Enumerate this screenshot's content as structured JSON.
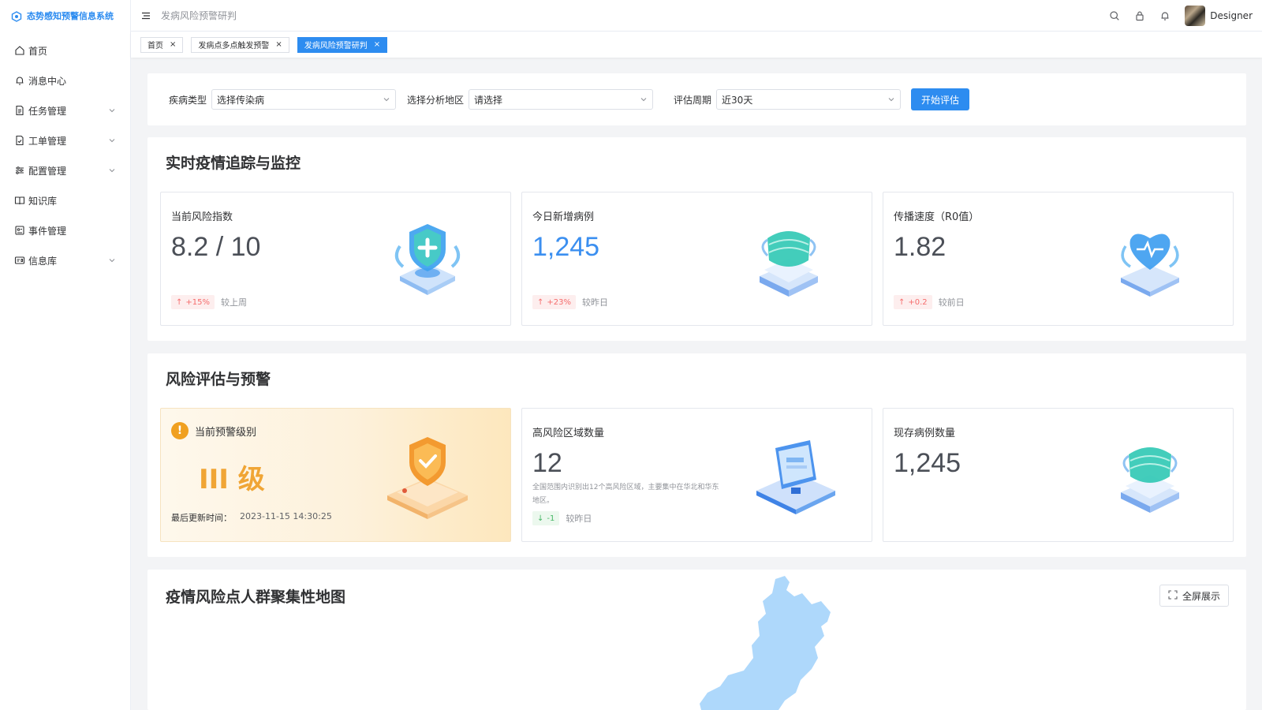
{
  "app": {
    "title": "态势感知预警信息系统"
  },
  "sidebar": {
    "items": [
      {
        "label": "首页",
        "icon": "home-icon",
        "has_children": false
      },
      {
        "label": "消息中心",
        "icon": "bell-icon",
        "has_children": false
      },
      {
        "label": "任务管理",
        "icon": "document-icon",
        "has_children": true
      },
      {
        "label": "工单管理",
        "icon": "file-check-icon",
        "has_children": true
      },
      {
        "label": "配置管理",
        "icon": "sliders-icon",
        "has_children": true
      },
      {
        "label": "知识库",
        "icon": "book-icon",
        "has_children": false
      },
      {
        "label": "事件管理",
        "icon": "event-icon",
        "has_children": false
      },
      {
        "label": "信息库",
        "icon": "id-card-icon",
        "has_children": true
      }
    ]
  },
  "header": {
    "breadcrumb": "发病风险预警研判",
    "user_name": "Designer"
  },
  "tabs": [
    {
      "label": "首页",
      "active": false
    },
    {
      "label": "发病点多点触发预警",
      "active": false
    },
    {
      "label": "发病风险预警研判",
      "active": true
    }
  ],
  "filters": {
    "disease_label": "疾病类型",
    "disease_value": "选择传染病",
    "region_label": "选择分析地区",
    "region_value": "请选择",
    "period_label": "评估周期",
    "period_value": "近30天",
    "start_button": "开始评估"
  },
  "realtime": {
    "title": "实时疫情追踪与监控",
    "cards": [
      {
        "title": "当前风险指数",
        "value": "8.2 / 10",
        "trend": "+15%",
        "compare": "较上周"
      },
      {
        "title": "今日新增病例",
        "value": "1,245",
        "trend": "+23%",
        "compare": "较昨日"
      },
      {
        "title": "传播速度（R0值）",
        "value": "1.82",
        "trend": "+0.2",
        "compare": "较前日"
      }
    ]
  },
  "risk": {
    "title": "风险评估与预警",
    "warning": {
      "title": "当前预警级别",
      "level": "III 级",
      "updated_label": "最后更新时间：",
      "updated_value": "2023-11-15 14:30:25"
    },
    "high_risk": {
      "title": "高风险区域数量",
      "value": "12",
      "desc": "全国范围内识别出12个高风险区域，主要集中在华北和华东地区。",
      "trend": "-1",
      "compare": "较昨日"
    },
    "existing": {
      "title": "现存病例数量",
      "value": "1,245"
    }
  },
  "map": {
    "title": "疫情风险点人群聚集性地图",
    "fullscreen_button": "全屏展示"
  },
  "colors": {
    "primary": "#2d8cf0",
    "warning": "#f0a535",
    "up": "#f56c6c",
    "down": "#47b766"
  }
}
